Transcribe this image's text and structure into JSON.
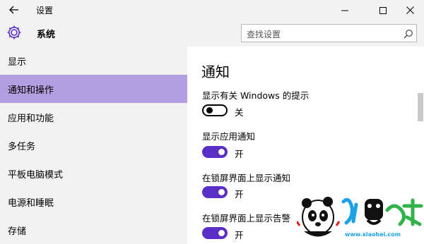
{
  "window": {
    "title": "设置",
    "back_icon": "arrow-left-icon",
    "controls": [
      "minimize-icon",
      "maximize-icon",
      "close-icon"
    ]
  },
  "sidebar": {
    "header_icon": "gear-icon",
    "header_title": "系统",
    "items": [
      {
        "label": "显示",
        "active": false
      },
      {
        "label": "通知和操作",
        "active": true
      },
      {
        "label": "应用和功能",
        "active": false
      },
      {
        "label": "多任务",
        "active": false
      },
      {
        "label": "平板电脑模式",
        "active": false
      },
      {
        "label": "电源和睡眠",
        "active": false
      },
      {
        "label": "存储",
        "active": false
      }
    ]
  },
  "search": {
    "placeholder": "查找设置",
    "icon": "search-icon"
  },
  "main": {
    "title": "通知",
    "settings": [
      {
        "label": "显示有关 Windows 的提示",
        "state": "关",
        "on": false
      },
      {
        "label": "显示应用通知",
        "state": "开",
        "on": true
      },
      {
        "label": "在锁屏界面上显示通知",
        "state": "开",
        "on": true
      },
      {
        "label": "在锁屏界面上显示告警",
        "state": "开",
        "on": true
      }
    ]
  },
  "colors": {
    "accent": "#5a2fc7",
    "active_nav": "#b19fe2",
    "sidebar_bg": "#f2f2f2"
  },
  "watermark": {
    "site": "www.xiaohei.com"
  }
}
